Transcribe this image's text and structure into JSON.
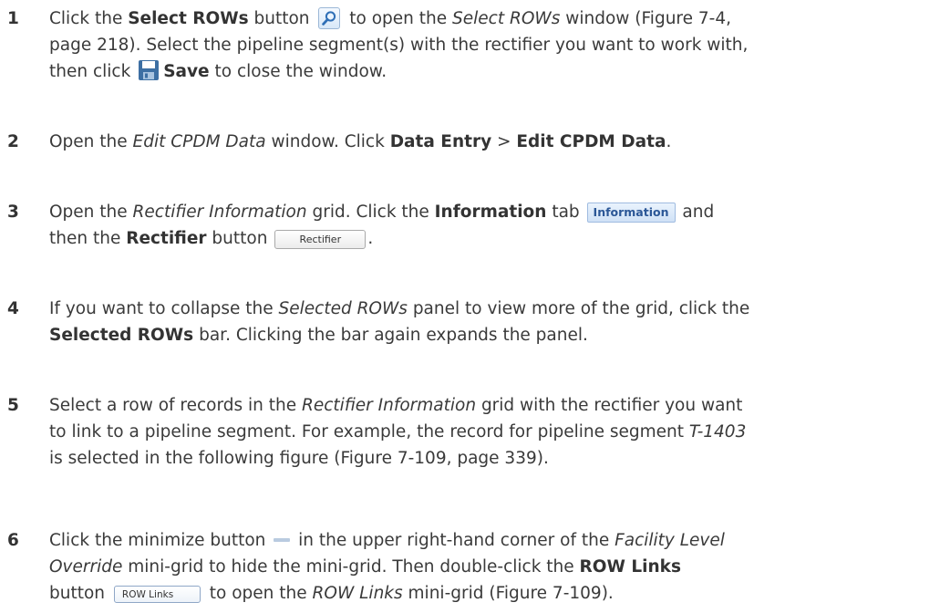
{
  "steps": [
    {
      "number": "1",
      "lines": [
        [
          "Click the ",
          "Select ROWs",
          " button ",
          "",
          " to open the ",
          "Select ROWs",
          " window (Figure 7-4,"
        ],
        [
          "page 218). Select the pipeline segment(s) with the rectifier you want to work with,"
        ],
        [
          "then click ",
          "",
          " ",
          "Save",
          " to close the window."
        ]
      ]
    },
    {
      "number": "2",
      "lines": [
        [
          "Open the ",
          "Edit CPDM Data",
          " window. Click ",
          "Data Entry",
          " > ",
          "Edit CPDM Data",
          "."
        ]
      ]
    },
    {
      "number": "3",
      "lines": [
        [
          "Open the ",
          "Rectifier Information",
          " grid. Click the ",
          "Information",
          " tab ",
          "Information",
          " and"
        ],
        [
          "then the ",
          "Rectifier",
          " button ",
          "Rectifier",
          "."
        ]
      ]
    },
    {
      "number": "4",
      "lines": [
        [
          "If you want to collapse the ",
          "Selected ROWs",
          " panel to view more of the grid, click the"
        ],
        [
          "Selected ROWs",
          " bar. Clicking the bar again expands the panel."
        ]
      ]
    },
    {
      "number": "5",
      "lines": [
        [
          "Select a row of records in the ",
          "Rectifier Information",
          " grid with the rectifier you want"
        ],
        [
          "to link to a pipeline segment. For example, the record for pipeline segment ",
          "T-1403"
        ],
        [
          "is selected in the following figure (Figure 7-109, page 339)."
        ]
      ]
    },
    {
      "number": "6",
      "lines": [
        [
          "Click the minimize button ",
          "",
          " in the upper right-hand corner of the ",
          "Facility Level"
        ],
        [
          "Override",
          " mini-grid to hide the mini-grid. Then double-click the ",
          "ROW Links"
        ],
        [
          "button ",
          "ROW Links",
          " to open the ",
          "ROW Links",
          " mini-grid (Figure 7-109)."
        ]
      ]
    }
  ],
  "icons": {
    "search": "magnifier-icon",
    "save": "floppy-disk-icon",
    "minimize": "minimize-icon"
  },
  "colors": {
    "text": "#3a3a3a",
    "tab_blue": "#2b5797"
  }
}
